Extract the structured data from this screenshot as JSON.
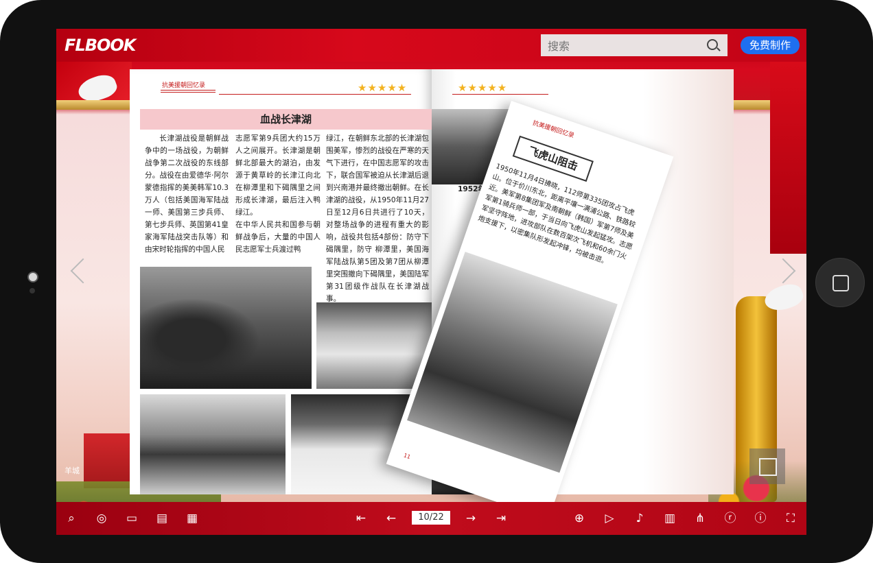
{
  "app": {
    "logo_text": "FLBOOK",
    "search_placeholder": "搜索",
    "free_button": "免费制作"
  },
  "book": {
    "left": {
      "header_small": "抗美援朝回忆录",
      "stars": "★★★★★",
      "title": "血战长津湖",
      "col1": "长津湖战役是朝鲜战争中的一场战役，为朝鲜战争第二次战役的东线部分。战役在由爱德华·阿尔蒙德指挥的美美韩军10.3万人（包括美国海军陆战一师、美国第三步兵师、第七步兵师、英国第41皇家海军陆战突击队等）和由宋时轮指挥的中国人民",
      "col2": "志愿军第9兵团大约15万人之间展开。长津湖是朝鲜北部最大的湖泊，由发源于黄草岭的长津江向北在柳潭里和下碣隅里之间形成长津湖，最后注入鸭绿江。\n在中华人民共和国参与朝鲜战争后，大量的中国人民志愿军士兵渡过鸭",
      "col3": "绿江，在朝鲜东北部的长津湖包围美军，惨烈的战役在严寒的天气下进行，在中国志愿军的攻击下，联合国军被迫从长津湖后退到兴南港并最终撤出朝鲜。在长津湖的战役，从1950年11月27日至12月6日共进行了10天，对整场战争的进程有重大的影响，战役共包括4部份：防守下碣隅里，防守 柳潭里，美国海军陆战队第5团及第7团从柳潭里突围撤向下碣隅里，美国陆军第31团级作战队在长津湖战事。"
    },
    "right": {
      "stars": "★★★★★",
      "text_start": "1952年10月"
    },
    "flip": {
      "header_small": "抗美援朝回忆录",
      "title": "飞虎山阻击",
      "text": "1950年11月4日拂晓，112师第335团攻占飞虎山。位于价川东北，距离平壤一满浦公路、铁路较近。美军第8集团军及南朝鲜（韩国）军第7师及美军第1骑兵师一部，于当日向飞虎山发起猛攻。志愿军坚守阵地，进攻部队在数百架次飞机和60余门火炮支援下，以密集队形发起冲锋，均被击退。",
      "page_num": "11"
    }
  },
  "toolbar": {
    "page_indicator": "10/22",
    "side_label": "羊城"
  },
  "colors": {
    "accent": "#1e6ff0",
    "brand_red": "#c8111e"
  }
}
